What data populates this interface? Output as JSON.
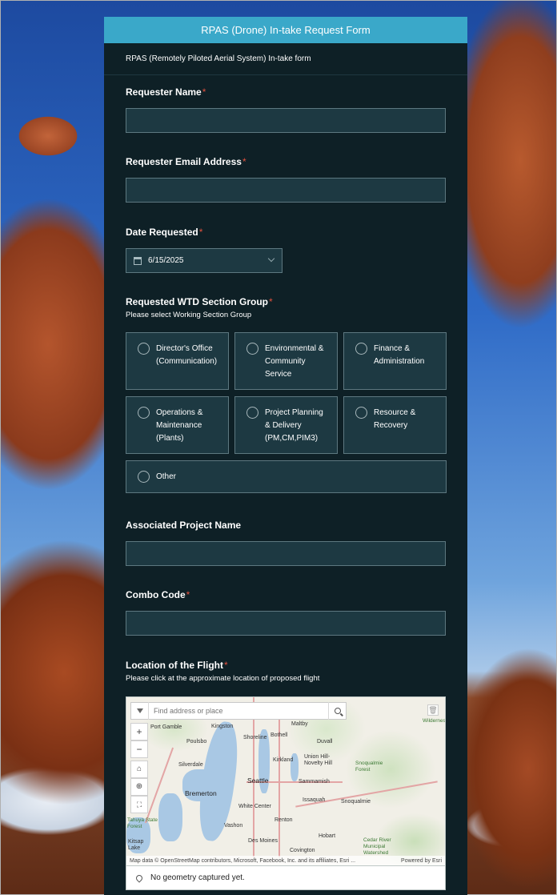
{
  "form": {
    "title": "RPAS (Drone) In-take Request Form",
    "description": "RPAS (Remotely Piloted Aerial System) In-take form",
    "required_marker": "*",
    "requester_name": {
      "label": "Requester Name",
      "value": ""
    },
    "requester_email": {
      "label": "Requester Email Address",
      "value": ""
    },
    "date_requested": {
      "label": "Date Requested",
      "value": "6/15/2025"
    },
    "section_group": {
      "label": "Requested WTD Section Group",
      "hint": "Please select Working Section Group",
      "options": [
        {
          "label": "Director's Office\n(Communication)"
        },
        {
          "label": "Environmental &\nCommunity\nService"
        },
        {
          "label": "Finance &\nAdministration"
        },
        {
          "label": "Operations &\nMaintenance\n(Plants)"
        },
        {
          "label": "Project Planning\n& Delivery\n(PM,CM,PIM3)"
        },
        {
          "label": "Resource &\nRecovery"
        },
        {
          "label": "Other"
        }
      ]
    },
    "project_name": {
      "label": "Associated Project Name",
      "value": ""
    },
    "combo_code": {
      "label": "Combo Code",
      "value": ""
    },
    "location": {
      "label": "Location of the Flight",
      "hint": "Please click at the approximate location of proposed flight",
      "search_placeholder": "Find address or place",
      "status": "No geometry captured yet.",
      "attribution_left": "Map data © OpenStreetMap contributors, Microsoft, Facebook, Inc. and its affiliates, Esri ...",
      "attribution_right": "Powered by Esri",
      "places": {
        "kingston": "Kingston",
        "shoreline": "Shoreline",
        "bothell": "Bothell",
        "maltby": "Maltby",
        "duvall": "Duvall",
        "poulsbo": "Poulsbo",
        "kirkland": "Kirkland",
        "union_hill": "Union Hill-\nNovelty Hill",
        "silverdale": "Silverdale",
        "seattle": "Seattle",
        "sammamish": "Sammamish",
        "snoqualmie_forest": "Snoqualmie\nForest",
        "bremerton": "Bremerton",
        "issaquah": "Issaquah",
        "snoqualmie": "Snoqualmie",
        "white_center": "White Center",
        "tahuya": "Tahuya State\nForest",
        "vashon": "Vashon",
        "renton": "Renton",
        "des_moines": "Des Moines",
        "hobart": "Hobart",
        "cedar_river": "Cedar River\nMunicipal\nWatershed",
        "covington": "Covington",
        "port_gamble": "Port Gamble",
        "wilderness": "Wildernes",
        "kitsap": "Kitsap\nLake"
      }
    }
  },
  "colors": {
    "header": "#3aa8c9",
    "panel": "#0e2026",
    "field": "#1d3942",
    "required": "#e0513f"
  }
}
